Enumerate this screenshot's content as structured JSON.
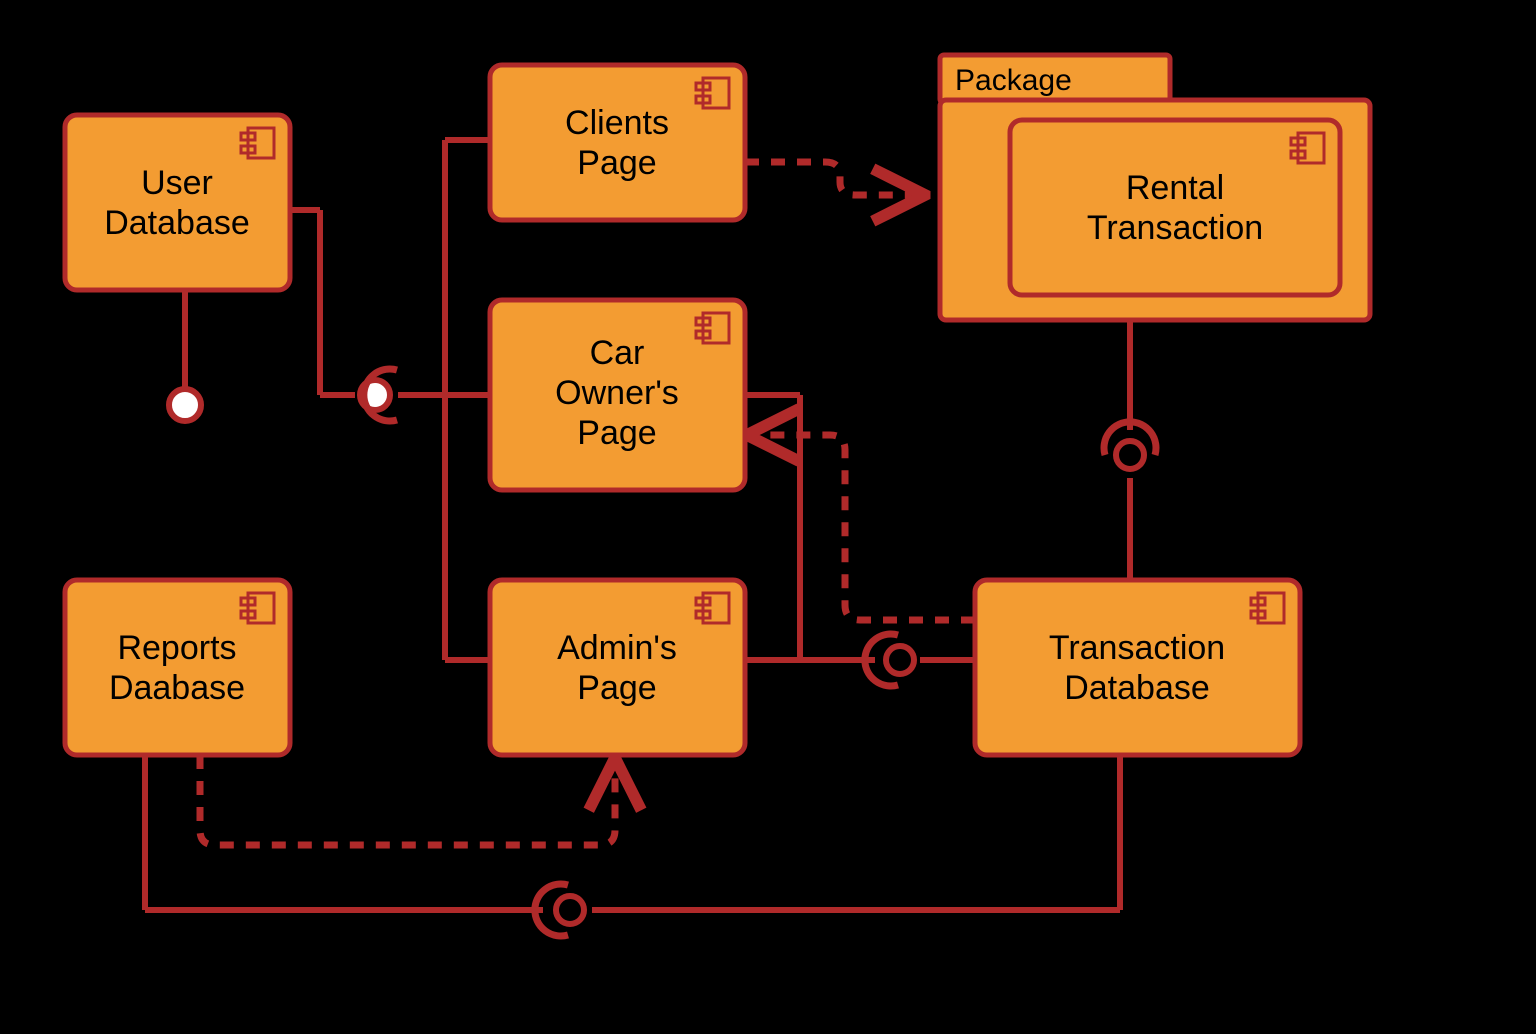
{
  "diagram": {
    "type": "uml-component",
    "components": {
      "userDatabase": {
        "line1": "User",
        "line2": "Database"
      },
      "reportsDatabase": {
        "line1": "Reports",
        "line2": "Daabase"
      },
      "clientsPage": {
        "line1": "Clients",
        "line2": "Page"
      },
      "carOwnersPage": {
        "line1": "Car",
        "line2": "Owner's",
        "line3": "Page"
      },
      "adminsPage": {
        "line1": "Admin's",
        "line2": "Page"
      },
      "rentalTransaction": {
        "line1": "Rental",
        "line2": "Transaction"
      },
      "transactionDatabase": {
        "line1": "Transaction",
        "line2": "Database"
      }
    },
    "package": {
      "label": "Package"
    },
    "connectors": [
      {
        "from": "userDatabase",
        "to": "environment",
        "kind": "provided-interface"
      },
      {
        "from": "pages-group",
        "to": "userDatabase-side",
        "kind": "required-interface"
      },
      {
        "from": "clientsPage",
        "to": "rentalTransaction",
        "kind": "dependency-dashed"
      },
      {
        "from": "package",
        "to": "transactionDatabase",
        "kind": "required-interface"
      },
      {
        "from": "carOwnersPage,adminsPage",
        "to": "transactionDatabase",
        "kind": "required-interface"
      },
      {
        "from": "reportsDatabase",
        "to": "adminsPage",
        "kind": "dependency-dashed"
      },
      {
        "from": "reportsDatabase",
        "to": "transactionDatabase",
        "kind": "required-interface"
      },
      {
        "from": "transactionDatabase",
        "to": "carOwnersPage",
        "kind": "dependency-dashed"
      }
    ]
  }
}
